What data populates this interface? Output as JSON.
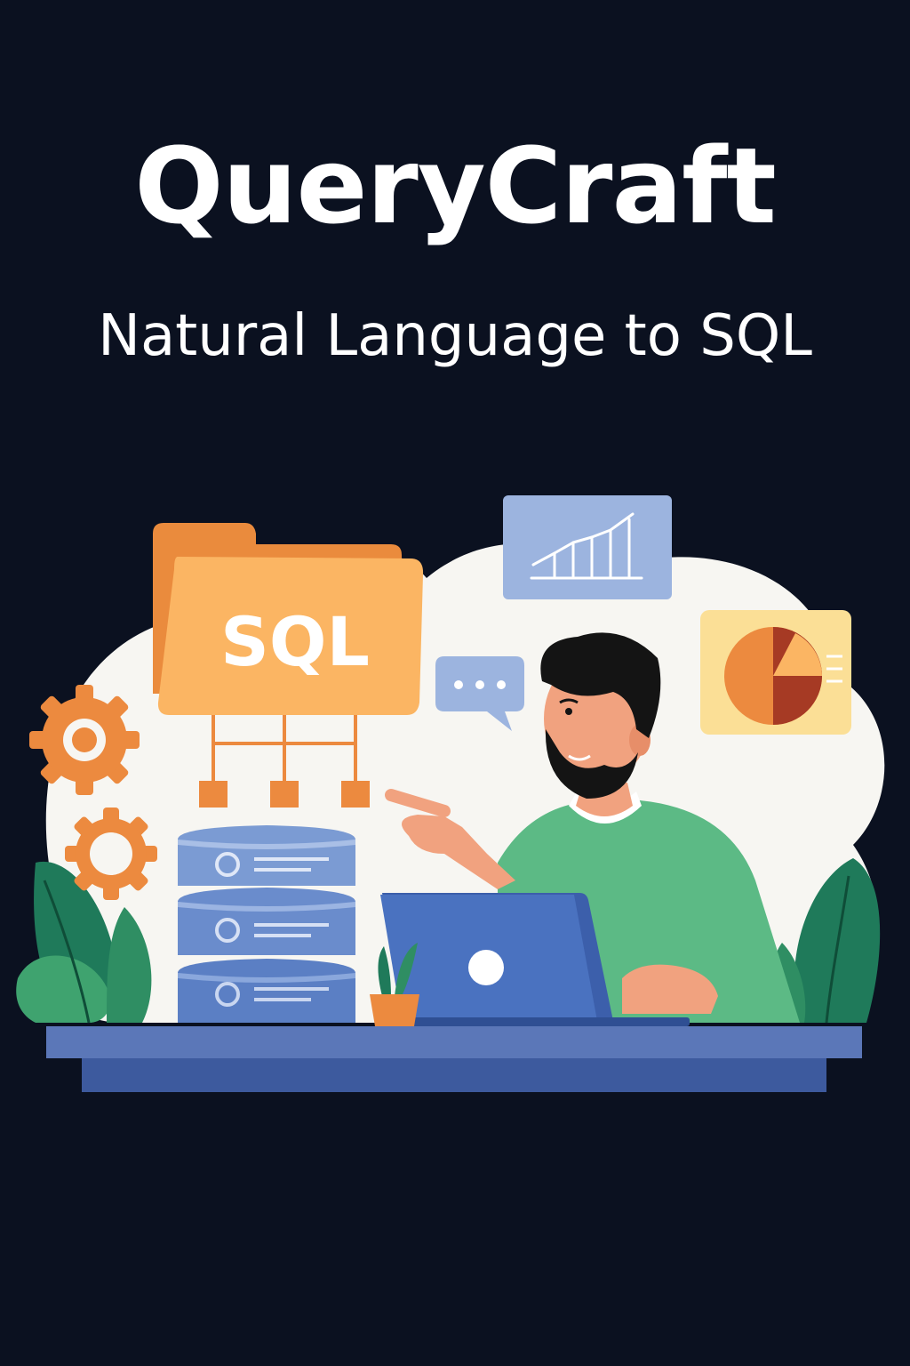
{
  "header": {
    "title": "QueryCraft",
    "subtitle": "Natural Language to SQL"
  },
  "illustration": {
    "folder_label": "SQL"
  },
  "colors": {
    "background": "#0b1120",
    "cloud": "#f7f6f2",
    "folder_orange": "#fbb563",
    "folder_back": "#ea8b3d",
    "gear_orange": "#ec8a3f",
    "server_blue": "#7b9bd3",
    "laptop_blue": "#4a72c0",
    "sweater_green": "#5cba85",
    "desk_blue": "#5b77b8",
    "panel_blue": "#9cb4df",
    "panel_yellow": "#fbdf96",
    "plant_green": "#1f7a5a"
  },
  "icons": [
    "sql-folder-icon",
    "bar-chart-icon",
    "pie-chart-icon",
    "chat-bubble-icon",
    "gear-icon",
    "database-server-icon",
    "laptop-icon",
    "plant-icon"
  ]
}
